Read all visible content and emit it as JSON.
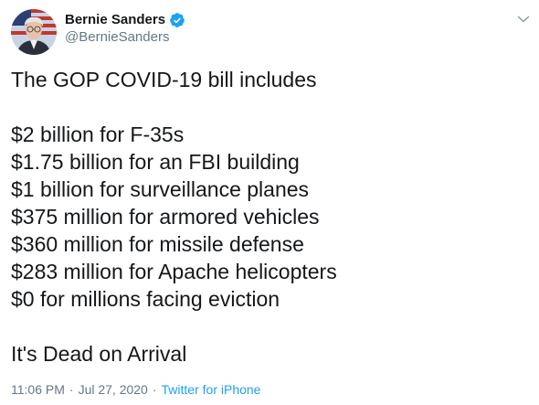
{
  "author": {
    "display_name": "Bernie Sanders",
    "handle": "@BernieSanders",
    "verified_icon": "verified-badge-icon",
    "avatar_icon": "profile-photo-icon"
  },
  "menu": {
    "icon": "chevron-down-icon"
  },
  "tweet": {
    "lines": [
      "The GOP COVID-19 bill includes",
      "",
      "$2 billion for F-35s",
      "$1.75 billion for an FBI building",
      "$1 billion for surveillance planes",
      "$375 million for armored vehicles",
      "$360 million for missile defense",
      "$283 million for Apache helicopters",
      "$0 for millions facing eviction",
      "",
      "It's Dead on Arrival"
    ]
  },
  "meta": {
    "time": "11:06 PM",
    "separator": "·",
    "date": "Jul 27, 2020",
    "source": "Twitter for iPhone"
  },
  "colors": {
    "text": "#14171a",
    "muted": "#657786",
    "accent": "#1da1f2"
  }
}
